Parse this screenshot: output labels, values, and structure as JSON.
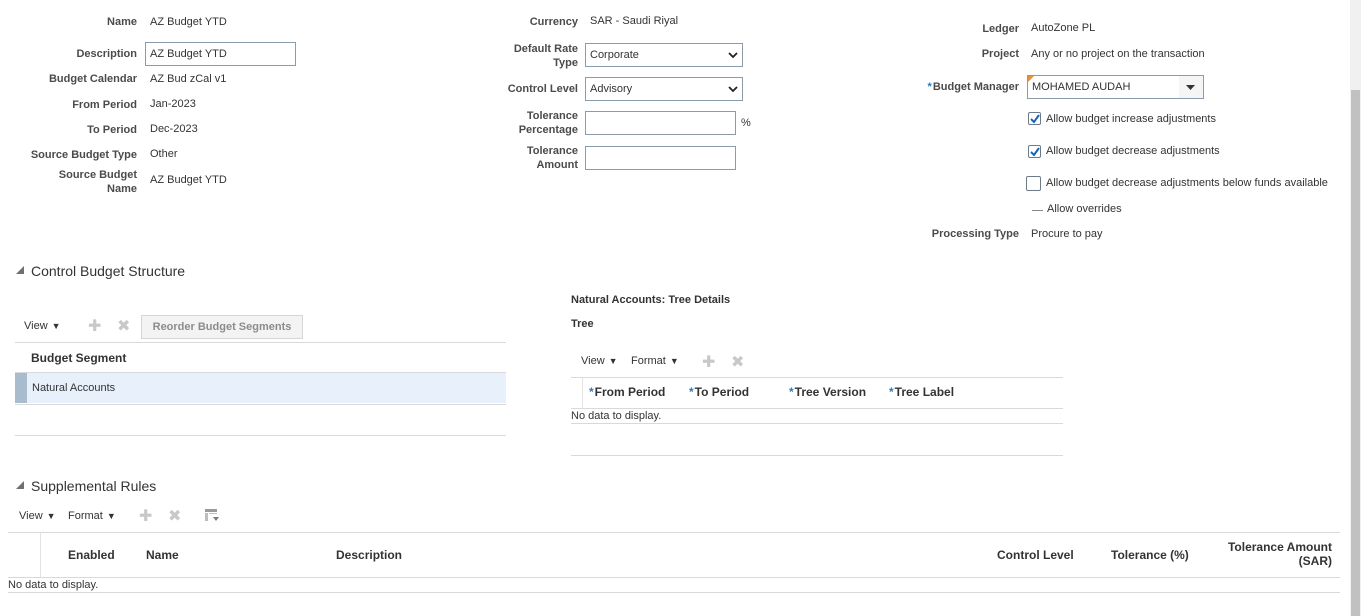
{
  "header": {
    "name_label": "Name",
    "name_value": "AZ Budget YTD",
    "description_label": "Description",
    "description_value": "AZ Budget YTD",
    "calendar_label": "Budget Calendar",
    "calendar_value": "AZ Bud zCal v1",
    "from_period_label": "From Period",
    "from_period_value": "Jan-2023",
    "to_period_label": "To Period",
    "to_period_value": "Dec-2023",
    "source_type_label": "Source Budget Type",
    "source_type_value": "Other",
    "source_name_label_1": "Source Budget",
    "source_name_label_2": "Name",
    "source_name_value": "AZ Budget YTD",
    "currency_label": "Currency",
    "currency_value": "SAR - Saudi Riyal",
    "rate_type_label_1": "Default Rate",
    "rate_type_label_2": "Type",
    "rate_type_value": "Corporate",
    "control_level_label": "Control Level",
    "control_level_value": "Advisory",
    "tol_pct_label_1": "Tolerance",
    "tol_pct_label_2": "Percentage",
    "tol_pct_value": "",
    "tol_pct_unit": "%",
    "tol_amt_label_1": "Tolerance",
    "tol_amt_label_2": "Amount",
    "tol_amt_value": "",
    "ledger_label": "Ledger",
    "ledger_value": "AutoZone PL",
    "project_label": "Project",
    "project_value": "Any or no project on the transaction",
    "manager_label": "Budget Manager",
    "manager_value": "MOHAMED AUDAH",
    "cb_increase": "Allow budget increase adjustments",
    "cb_decrease": "Allow budget decrease adjustments",
    "cb_below_funds": "Allow budget decrease adjustments below funds available",
    "allow_overrides": "Allow overrides",
    "processing_label": "Processing Type",
    "processing_value": "Procure to pay"
  },
  "checkboxes": {
    "increase": true,
    "decrease": true,
    "below_funds": false
  },
  "control_budget_structure": {
    "title": "Control Budget Structure",
    "view_label": "View",
    "reorder_button": "Reorder Budget Segments",
    "column_header": "Budget Segment",
    "rows": [
      "Natural Accounts"
    ]
  },
  "tree_details": {
    "title": "Natural Accounts: Tree Details",
    "subtitle": "Tree",
    "view_label": "View",
    "format_label": "Format",
    "columns": [
      "From Period",
      "To Period",
      "Tree Version",
      "Tree Label"
    ],
    "empty_text": "No data to display."
  },
  "supplemental_rules": {
    "title": "Supplemental Rules",
    "view_label": "View",
    "format_label": "Format",
    "columns": {
      "enabled": "Enabled",
      "name": "Name",
      "description": "Description",
      "control_level": "Control Level",
      "tolerance_pct": "Tolerance (%)",
      "tolerance_amt_1": "Tolerance Amount",
      "tolerance_amt_2": "(SAR)"
    },
    "empty_text": "No data to display."
  }
}
